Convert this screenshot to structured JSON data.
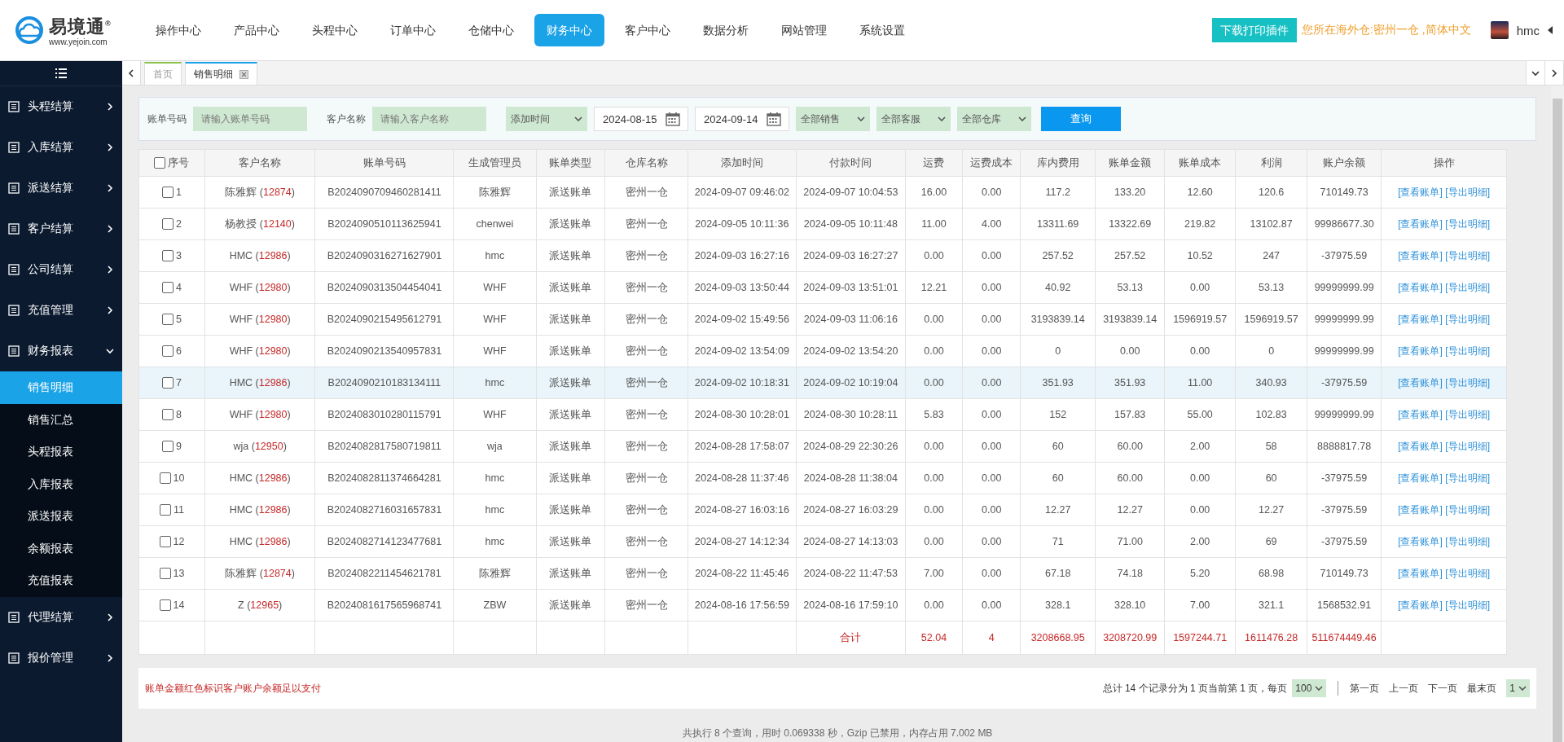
{
  "header": {
    "logo": {
      "name": "易境通",
      "mark": "®",
      "url": "www.yejoin.com"
    },
    "nav": [
      {
        "label": "操作中心",
        "selected": false
      },
      {
        "label": "产品中心",
        "selected": false
      },
      {
        "label": "头程中心",
        "selected": false
      },
      {
        "label": "订单中心",
        "selected": false
      },
      {
        "label": "仓储中心",
        "selected": false
      },
      {
        "label": "财务中心",
        "selected": true
      },
      {
        "label": "客户中心",
        "selected": false
      },
      {
        "label": "数据分析",
        "selected": false
      },
      {
        "label": "网站管理",
        "selected": false
      },
      {
        "label": "系统设置",
        "selected": false
      }
    ],
    "download_button": "下载打印插件",
    "location": "您所在海外仓:密州一仓 ,简体中文",
    "user": "hmc"
  },
  "sidebar": {
    "items": [
      {
        "label": "头程结算",
        "expanded": false
      },
      {
        "label": "入库结算",
        "expanded": false
      },
      {
        "label": "派送结算",
        "expanded": false
      },
      {
        "label": "客户结算",
        "expanded": false
      },
      {
        "label": "公司结算",
        "expanded": false
      },
      {
        "label": "充值管理",
        "expanded": false
      },
      {
        "label": "财务报表",
        "expanded": true,
        "children": [
          {
            "label": "销售明细",
            "selected": true
          },
          {
            "label": "销售汇总",
            "selected": false
          },
          {
            "label": "头程报表",
            "selected": false
          },
          {
            "label": "入库报表",
            "selected": false
          },
          {
            "label": "派送报表",
            "selected": false
          },
          {
            "label": "余额报表",
            "selected": false
          },
          {
            "label": "充值报表",
            "selected": false
          }
        ]
      },
      {
        "label": "代理结算",
        "expanded": false
      },
      {
        "label": "报价管理",
        "expanded": false
      }
    ]
  },
  "tabs": [
    {
      "label": "首页",
      "selected": false,
      "closable": false
    },
    {
      "label": "销售明细",
      "selected": true,
      "closable": true
    }
  ],
  "filters": {
    "bill_no": {
      "label": "账单号码",
      "placeholder": "请输入账单号码"
    },
    "customer": {
      "label": "客户名称",
      "placeholder": "请输入客户名称"
    },
    "time_type": "添加时间",
    "date_from": "2024-08-15",
    "date_to": "2024-09-14",
    "selects": [
      "全部销售",
      "全部客服",
      "全部仓库"
    ],
    "query_button": "查询"
  },
  "table": {
    "header_checked": false,
    "columns": [
      "序号",
      "客户名称",
      "账单号码",
      "生成管理员",
      "账单类型",
      "仓库名称",
      "添加时间",
      "付款时间",
      "运费",
      "运费成本",
      "库内费用",
      "账单金额",
      "账单成本",
      "利润",
      "账户余额",
      "操作"
    ],
    "rows": [
      {
        "checked": false,
        "selected": false,
        "cells": [
          "1",
          {
            "name": "陈雅辉 (",
            "id": "12874",
            "close": ")"
          },
          "B2024090709460281411",
          "陈雅辉",
          "派送账单",
          "密州一仓",
          "2024-09-07 09:46:02",
          "2024-09-07 10:04:53",
          "16.00",
          "0.00",
          "117.2",
          "133.20",
          "12.60",
          "120.6",
          "710149.73",
          [
            "[查看账单]",
            "[导出明细]"
          ]
        ]
      },
      {
        "checked": false,
        "selected": false,
        "cells": [
          "2",
          {
            "name": "杨教授 (",
            "id": "12140",
            "close": ")"
          },
          "B2024090510113625941",
          "chenwei",
          "派送账单",
          "密州一仓",
          "2024-09-05 10:11:36",
          "2024-09-05 10:11:48",
          "11.00",
          "4.00",
          "13311.69",
          "13322.69",
          "219.82",
          "13102.87",
          "99986677.30",
          [
            "[查看账单]",
            "[导出明细]"
          ]
        ]
      },
      {
        "checked": false,
        "selected": false,
        "cells": [
          "3",
          {
            "name": "HMC (",
            "id": "12986",
            "close": ")"
          },
          "B2024090316271627901",
          "hmc",
          "派送账单",
          "密州一仓",
          "2024-09-03 16:27:16",
          "2024-09-03 16:27:27",
          "0.00",
          "0.00",
          "257.52",
          "257.52",
          "10.52",
          "247",
          "-37975.59",
          [
            "[查看账单]",
            "[导出明细]"
          ]
        ]
      },
      {
        "checked": false,
        "selected": false,
        "cells": [
          "4",
          {
            "name": "WHF (",
            "id": "12980",
            "close": ")"
          },
          "B2024090313504454041",
          "WHF",
          "派送账单",
          "密州一仓",
          "2024-09-03 13:50:44",
          "2024-09-03 13:51:01",
          "12.21",
          "0.00",
          "40.92",
          "53.13",
          "0.00",
          "53.13",
          "99999999.99",
          [
            "[查看账单]",
            "[导出明细]"
          ]
        ]
      },
      {
        "checked": false,
        "selected": false,
        "cells": [
          "5",
          {
            "name": "WHF (",
            "id": "12980",
            "close": ")"
          },
          "B2024090215495612791",
          "WHF",
          "派送账单",
          "密州一仓",
          "2024-09-02 15:49:56",
          "2024-09-03 11:06:16",
          "0.00",
          "0.00",
          "3193839.14",
          "3193839.14",
          "1596919.57",
          "1596919.57",
          "99999999.99",
          [
            "[查看账单]",
            "[导出明细]"
          ]
        ]
      },
      {
        "checked": false,
        "selected": false,
        "cells": [
          "6",
          {
            "name": "WHF (",
            "id": "12980",
            "close": ")"
          },
          "B2024090213540957831",
          "WHF",
          "派送账单",
          "密州一仓",
          "2024-09-02 13:54:09",
          "2024-09-02 13:54:20",
          "0.00",
          "0.00",
          "0",
          "0.00",
          "0.00",
          "0",
          "99999999.99",
          [
            "[查看账单]",
            "[导出明细]"
          ]
        ]
      },
      {
        "checked": false,
        "selected": true,
        "cells": [
          "7",
          {
            "name": "HMC (",
            "id": "12986",
            "close": ")"
          },
          "B2024090210183134111",
          "hmc",
          "派送账单",
          "密州一仓",
          "2024-09-02 10:18:31",
          "2024-09-02 10:19:04",
          "0.00",
          "0.00",
          "351.93",
          "351.93",
          "11.00",
          "340.93",
          "-37975.59",
          [
            "[查看账单]",
            "[导出明细]"
          ]
        ]
      },
      {
        "checked": false,
        "selected": false,
        "cells": [
          "8",
          {
            "name": "WHF (",
            "id": "12980",
            "close": ")"
          },
          "B2024083010280115791",
          "WHF",
          "派送账单",
          "密州一仓",
          "2024-08-30 10:28:01",
          "2024-08-30 10:28:11",
          "5.83",
          "0.00",
          "152",
          "157.83",
          "55.00",
          "102.83",
          "99999999.99",
          [
            "[查看账单]",
            "[导出明细]"
          ]
        ]
      },
      {
        "checked": false,
        "selected": false,
        "cells": [
          "9",
          {
            "name": "wja (",
            "id": "12950",
            "close": ")"
          },
          "B2024082817580719811",
          "wja",
          "派送账单",
          "密州一仓",
          "2024-08-28 17:58:07",
          "2024-08-29 22:30:26",
          "0.00",
          "0.00",
          "60",
          "60.00",
          "2.00",
          "58",
          "8888817.78",
          [
            "[查看账单]",
            "[导出明细]"
          ]
        ]
      },
      {
        "checked": false,
        "selected": false,
        "cells": [
          "10",
          {
            "name": "HMC (",
            "id": "12986",
            "close": ")"
          },
          "B2024082811374664281",
          "hmc",
          "派送账单",
          "密州一仓",
          "2024-08-28 11:37:46",
          "2024-08-28 11:38:04",
          "0.00",
          "0.00",
          "60",
          "60.00",
          "0.00",
          "60",
          "-37975.59",
          [
            "[查看账单]",
            "[导出明细]"
          ]
        ]
      },
      {
        "checked": false,
        "selected": false,
        "cells": [
          "11",
          {
            "name": "HMC (",
            "id": "12986",
            "close": ")"
          },
          "B2024082716031657831",
          "hmc",
          "派送账单",
          "密州一仓",
          "2024-08-27 16:03:16",
          "2024-08-27 16:03:29",
          "0.00",
          "0.00",
          "12.27",
          "12.27",
          "0.00",
          "12.27",
          "-37975.59",
          [
            "[查看账单]",
            "[导出明细]"
          ]
        ]
      },
      {
        "checked": false,
        "selected": false,
        "cells": [
          "12",
          {
            "name": "HMC (",
            "id": "12986",
            "close": ")"
          },
          "B2024082714123477681",
          "hmc",
          "派送账单",
          "密州一仓",
          "2024-08-27 14:12:34",
          "2024-08-27 14:13:03",
          "0.00",
          "0.00",
          "71",
          "71.00",
          "2.00",
          "69",
          "-37975.59",
          [
            "[查看账单]",
            "[导出明细]"
          ]
        ]
      },
      {
        "checked": false,
        "selected": false,
        "cells": [
          "13",
          {
            "name": "陈雅辉 (",
            "id": "12874",
            "close": ")"
          },
          "B2024082211454621781",
          "陈雅辉",
          "派送账单",
          "密州一仓",
          "2024-08-22 11:45:46",
          "2024-08-22 11:47:53",
          "7.00",
          "0.00",
          "67.18",
          "74.18",
          "5.20",
          "68.98",
          "710149.73",
          [
            "[查看账单]",
            "[导出明细]"
          ]
        ]
      },
      {
        "checked": false,
        "selected": false,
        "cells": [
          "14",
          {
            "name": "Z (",
            "id": "12965",
            "close": ")"
          },
          "B2024081617565968741",
          "ZBW",
          "派送账单",
          "密州一仓",
          "2024-08-16 17:56:59",
          "2024-08-16 17:59:10",
          "0.00",
          "0.00",
          "328.1",
          "328.10",
          "7.00",
          "321.1",
          "1568532.91",
          [
            "[查看账单]",
            "[导出明细]"
          ]
        ]
      },
      {
        "kind": "total",
        "cells": [
          "",
          "",
          "",
          "",
          "",
          "",
          "",
          "合计",
          "52.04",
          "4",
          "3208668.95",
          "3208720.99",
          "1597244.71",
          "1611476.28",
          "511674449.46",
          ""
        ]
      }
    ]
  },
  "footer": {
    "note": "账单金额红色标识客户账户余额足以支付",
    "summary": "总计 14 个记录分为 1 页当前第 1 页，每页",
    "per_page": "100",
    "links": [
      "第一页",
      "上一页",
      "下一页",
      "最末页"
    ],
    "page": "1"
  },
  "stats": "共执行 8 个查询，用时 0.069338 秒，Gzip 已禁用，内存占用 7.002 MB"
}
